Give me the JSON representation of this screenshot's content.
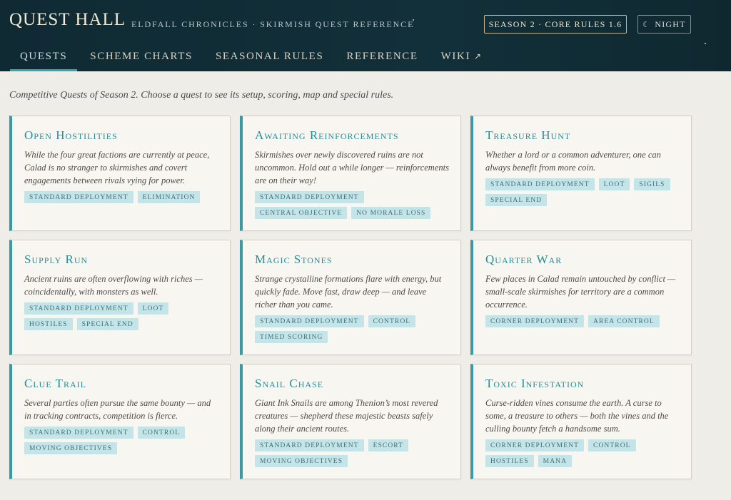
{
  "header": {
    "brand": "QUEST HALL",
    "subtitle": "Eldfall Chronicles · Skirmish Quest Reference",
    "season_pill": "Season 2 · Core Rules 1.6",
    "night_icon": "moon-icon",
    "night_label": "Night"
  },
  "nav": [
    {
      "label": "Quests",
      "active": true
    },
    {
      "label": "Scheme Charts",
      "active": false
    },
    {
      "label": "Seasonal Rules",
      "active": false
    },
    {
      "label": "Reference",
      "active": false
    },
    {
      "label": "Wiki",
      "icon": "external-link-icon",
      "active": false
    }
  ],
  "intro": "Competitive Quests of Season 2. Choose a quest to see its setup, scoring, map and special rules.",
  "quests": [
    {
      "title": "Open Hostilities",
      "description": "While the four great factions are currently at peace, Calad is no stranger to skirmishes and covert engagements between rivals vying for power.",
      "tags": [
        "Standard Deployment",
        "Elimination"
      ]
    },
    {
      "title": "Awaiting Reinforcements",
      "description": "Skirmishes over newly discovered ruins are not uncommon. Hold out a while longer — reinforcements are on their way!",
      "tags": [
        "Standard Deployment",
        "Central Objective",
        "No Morale Loss"
      ]
    },
    {
      "title": "Treasure Hunt",
      "description": "Whether a lord or a common adventurer, one can always benefit from more coin.",
      "tags": [
        "Standard Deployment",
        "Loot",
        "Sigils",
        "Special End"
      ]
    },
    {
      "title": "Supply Run",
      "description": "Ancient ruins are often overflowing with riches — coincidentally, with monsters as well.",
      "tags": [
        "Standard Deployment",
        "Loot",
        "Hostiles",
        "Special End"
      ]
    },
    {
      "title": "Magic Stones",
      "description": "Strange crystalline formations flare with energy, but quickly fade. Move fast, draw deep — and leave richer than you came.",
      "tags": [
        "Standard Deployment",
        "Control",
        "Timed Scoring"
      ]
    },
    {
      "title": "Quarter War",
      "description": "Few places in Calad remain untouched by conflict — small-scale skirmishes for territory are a common occurrence.",
      "tags": [
        "Corner Deployment",
        "Area Control"
      ]
    },
    {
      "title": "Clue Trail",
      "description": "Several parties often pursue the same bounty — and in tracking contracts, competition is fierce.",
      "tags": [
        "Standard Deployment",
        "Control",
        "Moving Objectives"
      ]
    },
    {
      "title": "Snail Chase",
      "description": "Giant Ink Snails are among Thenion’s most revered creatures — shepherd these majestic beasts safely along their ancient routes.",
      "tags": [
        "Standard Deployment",
        "Escort",
        "Moving Objectives"
      ]
    },
    {
      "title": "Toxic Infestation",
      "description": "Curse-ridden vines consume the earth. A curse to some, a treasure to others — both the vines and the culling bounty fetch a handsome sum.",
      "tags": [
        "Corner Deployment",
        "Control",
        "Hostiles",
        "Mana"
      ]
    }
  ],
  "colors": {
    "header_bg": "#12303a",
    "accent": "#3a9aa3",
    "tag_bg": "#c4e4e8",
    "page_bg": "#efede8"
  }
}
